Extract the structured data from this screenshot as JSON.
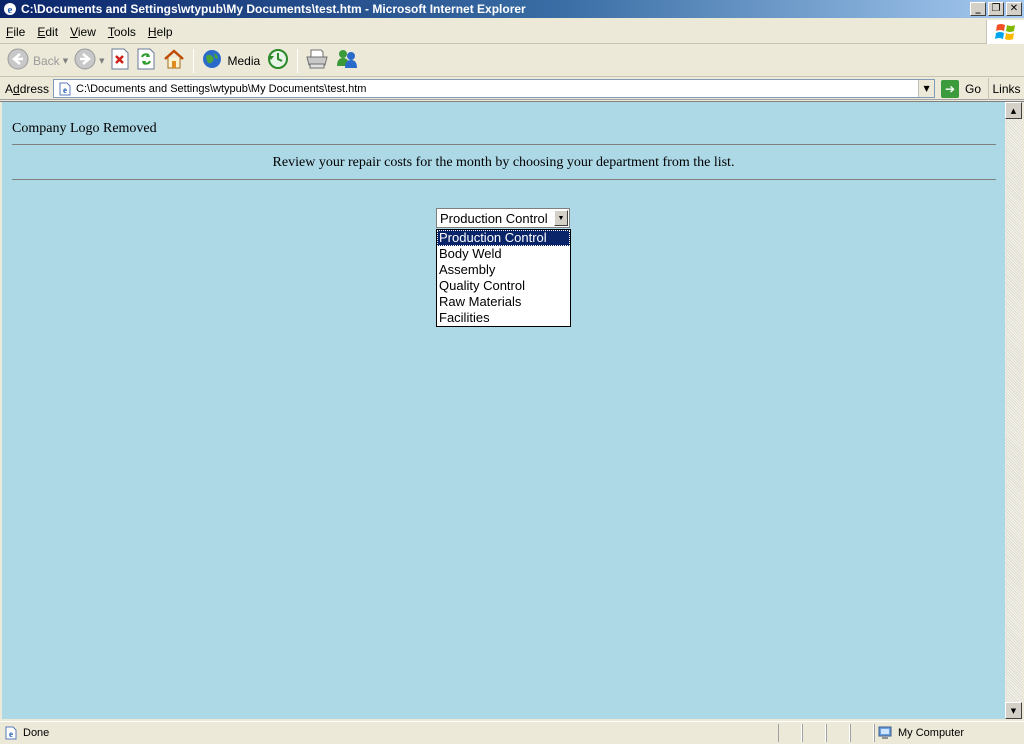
{
  "window": {
    "title": "C:\\Documents and Settings\\wtypub\\My Documents\\test.htm - Microsoft Internet Explorer",
    "minimize": "_",
    "restore": "❐",
    "close": "✕"
  },
  "menu": {
    "items": [
      {
        "accel": "F",
        "rest": "ile"
      },
      {
        "accel": "E",
        "rest": "dit"
      },
      {
        "accel": "V",
        "rest": "iew"
      },
      {
        "accel": "T",
        "rest": "ools"
      },
      {
        "accel": "H",
        "rest": "elp"
      }
    ]
  },
  "toolbar": {
    "back_label": "Back",
    "media_label": "Media"
  },
  "address": {
    "label_accel": "d",
    "label_pre": "A",
    "label_post": "dress",
    "value": "C:\\Documents and Settings\\wtypub\\My Documents\\test.htm",
    "go_label": "Go",
    "links_label": "Links"
  },
  "page": {
    "logo_text": "Company Logo Removed",
    "instruction": "Review your repair costs for the month by choosing your department from the list.",
    "background_color": "#add8e6",
    "department_select": {
      "selected": "Production Control",
      "options": [
        "Production Control",
        "Body Weld",
        "Assembly",
        "Quality Control",
        "Raw Materials",
        "Facilities"
      ],
      "highlighted_index": 0
    }
  },
  "status": {
    "text": "Done",
    "zone": "My Computer"
  },
  "icons": {
    "app": "ie-icon",
    "back": "back-arrow-icon",
    "forward": "forward-arrow-icon",
    "stop": "stop-icon",
    "refresh": "refresh-icon",
    "home": "home-icon",
    "media": "media-icon",
    "history": "history-icon",
    "print": "print-icon",
    "messenger": "messenger-icon"
  }
}
